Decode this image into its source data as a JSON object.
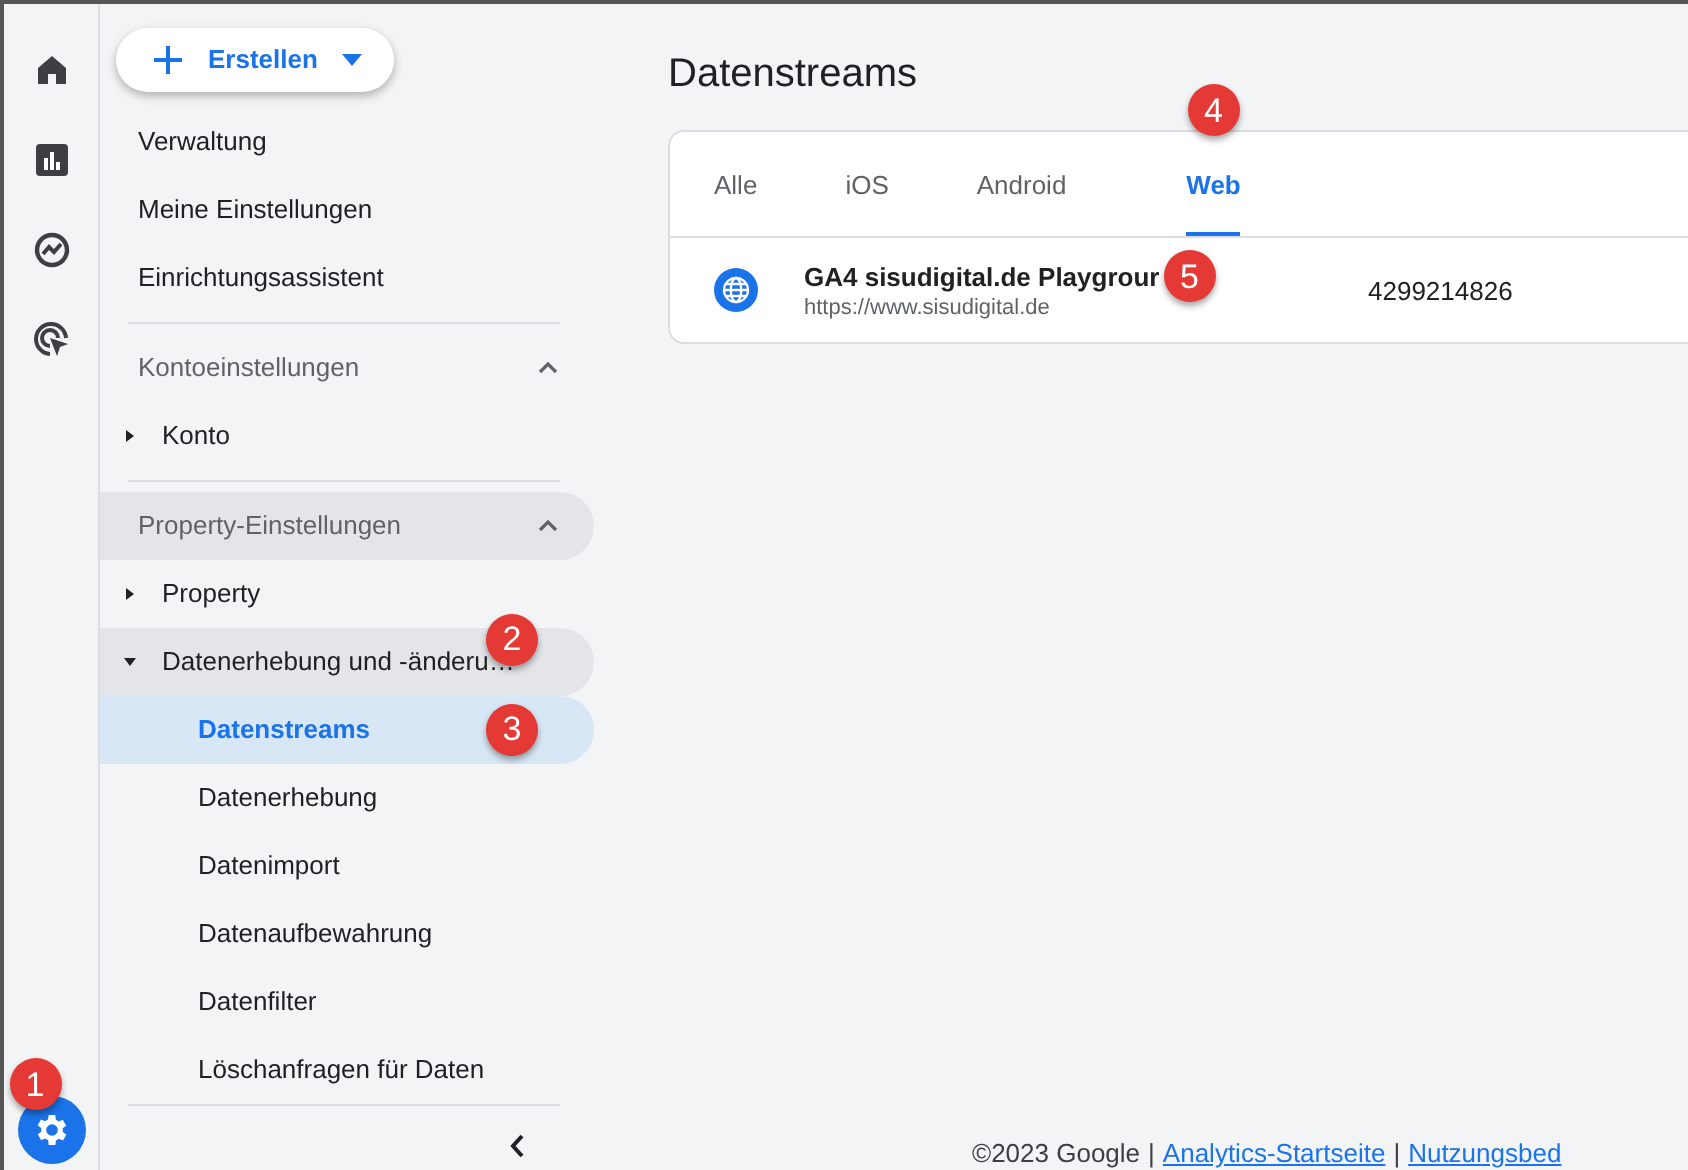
{
  "rail": {
    "items": [
      {
        "selected": false
      },
      {
        "selected": false
      },
      {
        "selected": false
      },
      {
        "selected": false
      }
    ],
    "settings": {
      "selected": true,
      "badge": "1"
    }
  },
  "sidebar": {
    "create_button": "Erstellen",
    "items": [
      {
        "kind": "link",
        "label": "Verwaltung"
      },
      {
        "kind": "link",
        "label": "Meine Einstellungen"
      },
      {
        "kind": "link",
        "label": "Einrichtungsassistent"
      },
      {
        "kind": "divider"
      },
      {
        "kind": "section",
        "label": "Kontoeinstellungen",
        "expanded": true,
        "highlighted": false
      },
      {
        "kind": "tree",
        "label": "Konto",
        "expanded": false,
        "highlighted": false
      },
      {
        "kind": "divider"
      },
      {
        "kind": "section",
        "label": "Property-Einstellungen",
        "expanded": true,
        "highlighted": true
      },
      {
        "kind": "tree",
        "label": "Property",
        "expanded": false,
        "highlighted": false
      },
      {
        "kind": "tree",
        "label": "Datenerhebung und -änderu…",
        "expanded": true,
        "highlighted": true,
        "badge": "2"
      },
      {
        "kind": "sub",
        "label": "Datenstreams",
        "selected": true,
        "badge": "3"
      },
      {
        "kind": "sub",
        "label": "Datenerhebung",
        "selected": false
      },
      {
        "kind": "sub",
        "label": "Datenimport",
        "selected": false
      },
      {
        "kind": "sub",
        "label": "Datenaufbewahrung",
        "selected": false
      },
      {
        "kind": "sub",
        "label": "Datenfilter",
        "selected": false
      },
      {
        "kind": "sub",
        "label": "Löschanfragen für Daten",
        "selected": false
      }
    ]
  },
  "main": {
    "title": "Datenstreams",
    "tabs": [
      {
        "label": "Alle",
        "selected": false
      },
      {
        "label": "iOS",
        "selected": false
      },
      {
        "label": "Android",
        "selected": false
      },
      {
        "label": "Web",
        "selected": true,
        "badge": "4"
      }
    ],
    "streams": [
      {
        "name": "GA4 sisudigital.de Playgrour",
        "url": "https://www.sisudigital.de",
        "id": "4299214826",
        "badge": "5"
      }
    ]
  },
  "footer": {
    "copyright": "©2023 Google",
    "separator": "|",
    "links": [
      "Analytics-Startseite",
      "Nutzungsbed"
    ]
  }
}
